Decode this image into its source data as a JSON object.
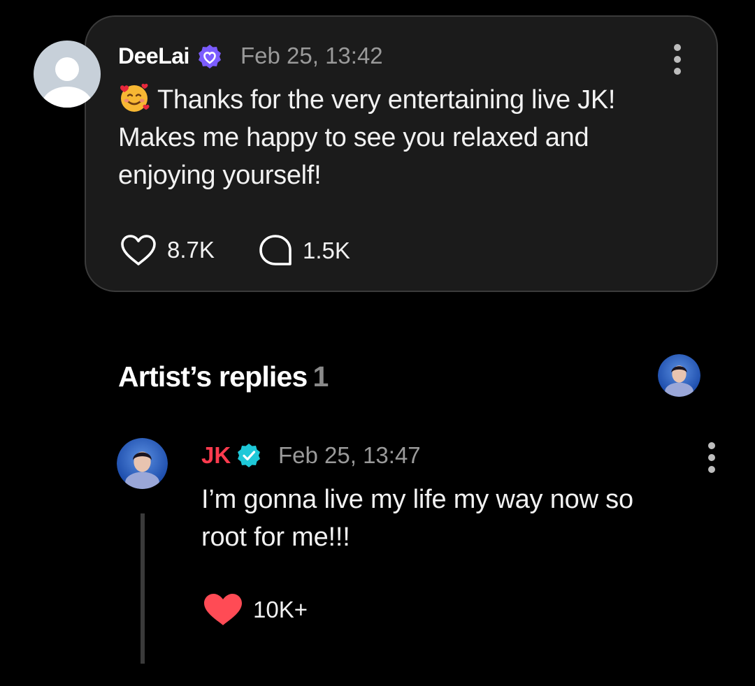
{
  "comment": {
    "author": "DeeLai",
    "timestamp": "Feb 25, 13:42",
    "emoji_icon": "smiling-face-with-hearts-icon",
    "body_lines": [
      "Thanks for the very entertaining live JK!",
      "Makes me happy to see you relaxed and",
      "enjoying yourself!"
    ],
    "likes": "8.7K",
    "replies": "1.5K",
    "badge_color": "#7b5cff"
  },
  "artist_replies": {
    "title": "Artist’s replies",
    "count": "1"
  },
  "reply": {
    "author": "JK",
    "author_color": "#ff3b4e",
    "badge_color": "#1ec8d8",
    "timestamp": "Feb 25, 13:47",
    "body_lines": [
      "I’m gonna live my life my way now so",
      "root for me!!!"
    ],
    "likes": "10K+",
    "liked": true,
    "liked_color": "#ff4b55"
  }
}
